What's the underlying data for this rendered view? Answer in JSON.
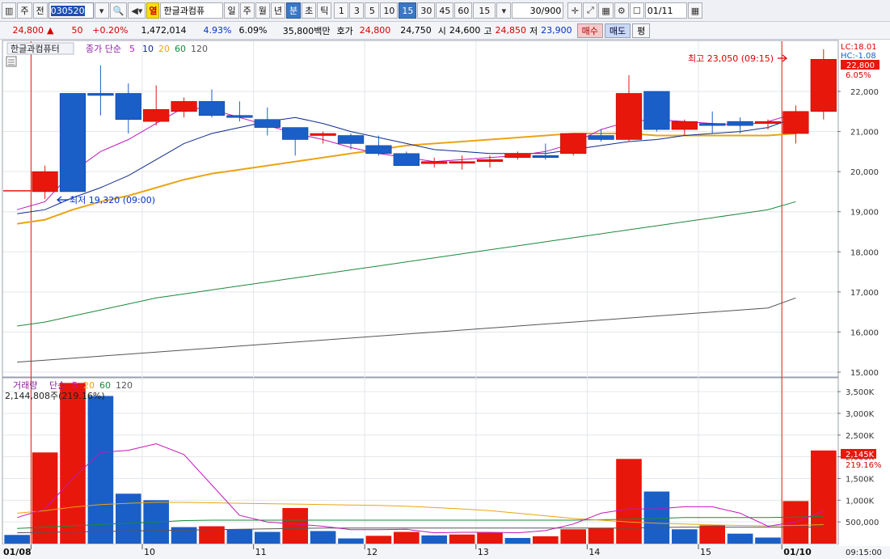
{
  "toolbar": {
    "type_label": "주",
    "prev_label": "전",
    "code": "030520",
    "period_tag": "열",
    "stock_name": "한글과컴퓨",
    "periods": [
      "일",
      "주",
      "월",
      "년",
      "분",
      "초",
      "틱"
    ],
    "active_period": "분",
    "minutes": [
      "1",
      "3",
      "5",
      "10",
      "15",
      "30",
      "45",
      "60"
    ],
    "active_minute": "15",
    "interval_value": "15",
    "count": "30/900",
    "date": "01/11"
  },
  "quote": {
    "price": "24,800",
    "change": "50",
    "change_pct": "+0.20%",
    "volume": "1,472,014",
    "turnover_pct": "4.93%",
    "volatility_pct": "6.09%",
    "amount": "35,800백만",
    "ask_label": "호가",
    "ask_value": "24,800",
    "bid_value": "24,750",
    "open_label": "시",
    "open_value": "24,600",
    "high_label": "고",
    "high_value": "24,850",
    "low_label": "저",
    "low_value": "23,900",
    "buy_label": "매수",
    "sell_label": "매도",
    "avg_label": "평"
  },
  "colors": {
    "up": "#e8170c",
    "down": "#1a5fc7",
    "ma5": "#c218b8",
    "ma10": "#0f2a8c",
    "ma20": "#eaa414",
    "ma60": "#1a8a3c",
    "ma120": "#555555"
  },
  "price_panel": {
    "legend_name": "한글과컴퓨터",
    "legend_type": "종가 단순",
    "legend_periods": [
      "5",
      "10",
      "20",
      "60",
      "120"
    ],
    "lc_label": "LC:18.01",
    "hc_label": "HC:-1.08",
    "current_price_tag": "22,800",
    "current_pct_tag": "6.05%",
    "high_annotation": "최고 23,050 (09:15)",
    "low_annotation": "최저 19,320 (09:00)",
    "y_ticks": [
      "22,000",
      "21,000",
      "20,000",
      "19,000",
      "18,000",
      "17,000",
      "16,000",
      "15,000"
    ]
  },
  "volume_panel": {
    "legend_name": "거래량",
    "legend_type": "단순",
    "legend_periods": [
      "5",
      "20",
      "60",
      "120"
    ],
    "current_volume_label": "2,144,808주(219.16%)",
    "current_volume_tag": "2,145K",
    "current_pct_tag": "219.16%",
    "y_ticks": [
      "3,500K",
      "3,000K",
      "2,500K",
      "2,000K",
      "1,500K",
      "1,000K",
      "500,000"
    ]
  },
  "x_axis": {
    "labels": [
      "01/08",
      "10",
      "11",
      "12",
      "13",
      "14",
      "15",
      "01/10"
    ],
    "time_label": "09:15:00"
  },
  "chart_data": {
    "type": "candlestick",
    "unit": "KRW",
    "candles": [
      {
        "o": 19500,
        "h": 20150,
        "l": 19320,
        "c": 20000
      },
      {
        "o": 21950,
        "h": 21950,
        "l": 19500,
        "c": 19500
      },
      {
        "o": 21950,
        "h": 22650,
        "l": 21400,
        "c": 21900
      },
      {
        "o": 21950,
        "h": 22200,
        "l": 20950,
        "c": 21300
      },
      {
        "o": 21250,
        "h": 22150,
        "l": 21150,
        "c": 21550
      },
      {
        "o": 21500,
        "h": 21850,
        "l": 21350,
        "c": 21750
      },
      {
        "o": 21750,
        "h": 22050,
        "l": 21350,
        "c": 21400
      },
      {
        "o": 21400,
        "h": 21750,
        "l": 21250,
        "c": 21350
      },
      {
        "o": 21300,
        "h": 21600,
        "l": 20900,
        "c": 21100
      },
      {
        "o": 21100,
        "h": 21100,
        "l": 20400,
        "c": 20800
      },
      {
        "o": 20900,
        "h": 21000,
        "l": 20700,
        "c": 20950
      },
      {
        "o": 20900,
        "h": 20950,
        "l": 20550,
        "c": 20700
      },
      {
        "o": 20650,
        "h": 20900,
        "l": 20400,
        "c": 20450
      },
      {
        "o": 20450,
        "h": 20500,
        "l": 20150,
        "c": 20150
      },
      {
        "o": 20200,
        "h": 20350,
        "l": 20100,
        "c": 20250
      },
      {
        "o": 20250,
        "h": 20400,
        "l": 20050,
        "c": 20250
      },
      {
        "o": 20250,
        "h": 20400,
        "l": 20100,
        "c": 20300
      },
      {
        "o": 20350,
        "h": 20500,
        "l": 20300,
        "c": 20450
      },
      {
        "o": 20400,
        "h": 20700,
        "l": 20300,
        "c": 20350
      },
      {
        "o": 20450,
        "h": 20950,
        "l": 20400,
        "c": 20950
      },
      {
        "o": 20900,
        "h": 21050,
        "l": 20750,
        "c": 20800
      },
      {
        "o": 20800,
        "h": 22400,
        "l": 20750,
        "c": 21950
      },
      {
        "o": 22000,
        "h": 22000,
        "l": 21000,
        "c": 21050
      },
      {
        "o": 21050,
        "h": 21300,
        "l": 20900,
        "c": 21250
      },
      {
        "o": 21200,
        "h": 21500,
        "l": 20950,
        "c": 21150
      },
      {
        "o": 21250,
        "h": 21350,
        "l": 20950,
        "c": 21150
      },
      {
        "o": 21200,
        "h": 21300,
        "l": 21050,
        "c": 21250
      },
      {
        "o": 20950,
        "h": 21650,
        "l": 20700,
        "c": 21500
      },
      {
        "o": 21500,
        "h": 23050,
        "l": 21300,
        "c": 22800
      }
    ],
    "ma5": [
      19050,
      19250,
      20000,
      20500,
      20800,
      21200,
      21600,
      21550,
      21350,
      21150,
      20950,
      20800,
      20600,
      20450,
      20350,
      20250,
      20300,
      20350,
      20400,
      20500,
      20700,
      21050,
      21250,
      21300,
      21250,
      21200,
      21150,
      21250,
      21450
    ],
    "ma10": [
      18950,
      19050,
      19350,
      19600,
      19900,
      20300,
      20700,
      20950,
      21100,
      21250,
      21350,
      21200,
      21000,
      20850,
      20700,
      20550,
      20500,
      20450,
      20450,
      20450,
      20550,
      20650,
      20750,
      20800,
      20900,
      20950,
      21000,
      21100,
      21350
    ],
    "ma20": [
      18700,
      18800,
      19050,
      19250,
      19400,
      19600,
      19800,
      19950,
      20050,
      20150,
      20250,
      20350,
      20450,
      20550,
      20650,
      20700,
      20750,
      20800,
      20850,
      20900,
      20950,
      20950,
      20950,
      20900,
      20900,
      20900,
      20900,
      20900,
      20950
    ],
    "ma60": [
      16150,
      16250,
      16400,
      16550,
      16700,
      16850,
      16950,
      17050,
      17150,
      17250,
      17350,
      17450,
      17550,
      17650,
      17750,
      17850,
      17950,
      18050,
      18150,
      18250,
      18350,
      18450,
      18550,
      18650,
      18750,
      18850,
      18950,
      19050,
      19250
    ],
    "ma120": [
      15250,
      15300,
      15350,
      15400,
      15450,
      15500,
      15550,
      15600,
      15650,
      15700,
      15750,
      15800,
      15850,
      15900,
      15950,
      16000,
      16050,
      16100,
      16150,
      16200,
      16250,
      16300,
      16350,
      16400,
      16450,
      16500,
      16550,
      16600,
      16850
    ],
    "volume": [
      200,
      2100,
      3700,
      3400,
      1150,
      1000,
      380,
      400,
      330,
      270,
      820,
      290,
      120,
      180,
      270,
      190,
      210,
      250,
      130,
      170,
      330,
      360,
      1950,
      1200,
      330,
      420,
      230,
      140,
      980,
      2145
    ],
    "volume_ma5": [
      600,
      800,
      1500,
      2100,
      2150,
      2300,
      2050,
      1350,
      650,
      500,
      450,
      400,
      320,
      320,
      330,
      250,
      260,
      260,
      250,
      300,
      450,
      700,
      800,
      800,
      850,
      850,
      700,
      400,
      500,
      750
    ],
    "volume_ma20": [
      700,
      760,
      840,
      900,
      930,
      950,
      950,
      940,
      930,
      920,
      910,
      900,
      890,
      880,
      860,
      830,
      800,
      760,
      700,
      640,
      580,
      540,
      500,
      470,
      450,
      430,
      420,
      410,
      420,
      440
    ],
    "volume_ma60": [
      350,
      380,
      410,
      440,
      470,
      500,
      530,
      540,
      540,
      540,
      540,
      540,
      540,
      540,
      540,
      540,
      540,
      540,
      540,
      540,
      540,
      550,
      560,
      580,
      600,
      600,
      600,
      600,
      610,
      630
    ],
    "volume_ma120": [
      250,
      260,
      270,
      280,
      290,
      300,
      310,
      320,
      330,
      340,
      350,
      360,
      360,
      360,
      360,
      360,
      360,
      360,
      360,
      360,
      360,
      360,
      360,
      370,
      380,
      380,
      380,
      380,
      380,
      380
    ],
    "y_range_price": [
      14900,
      23250
    ],
    "y_range_volume": [
      0,
      3800
    ]
  }
}
